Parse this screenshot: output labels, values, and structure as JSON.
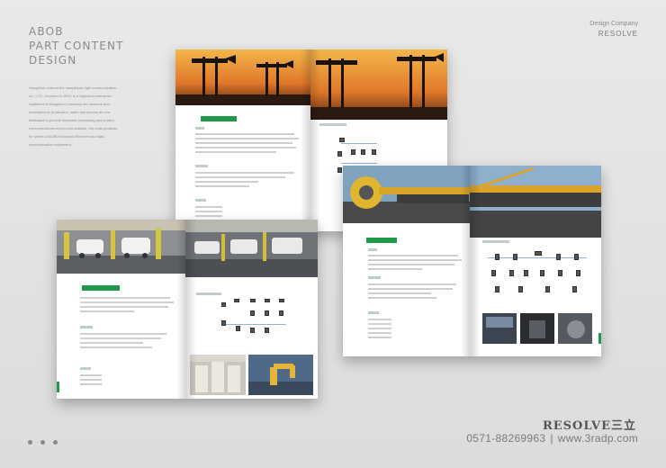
{
  "heading": {
    "lines": [
      "ABOB",
      "PART CONTENT",
      "DESIGN"
    ]
  },
  "intro": {
    "lines": [
      "Hangzhou entered the maxpliduse light communication",
      "co., LTD., founded in 2009, is a high-tech enterprise",
      "registered in hangzhou.Company set research and",
      "development, production, sales and service as one,",
      "dedicated to provide industrial networking and control",
      "communications end-to-end solution, the main products",
      "for series of AOBO industrial Ethernet and data",
      "communication equipment."
    ]
  },
  "company": {
    "label": "Design Company",
    "name": "RESOLVE"
  },
  "brand": {
    "logo_latin": "RESOLVE",
    "logo_cjk": "三立"
  },
  "contact": {
    "phone": "0571-88269963",
    "separator": "|",
    "website": "www.3radp.com"
  },
  "colors": {
    "accent_green": "#1f9a4a",
    "background": "#e3e3e3"
  },
  "brochures": [
    {
      "id": "oil-field",
      "photo_subject": "oil pump jacks at sunset"
    },
    {
      "id": "car-factory",
      "photo_subject": "automotive assembly line"
    },
    {
      "id": "mining",
      "photo_subject": "bucket wheel excavator"
    }
  ]
}
